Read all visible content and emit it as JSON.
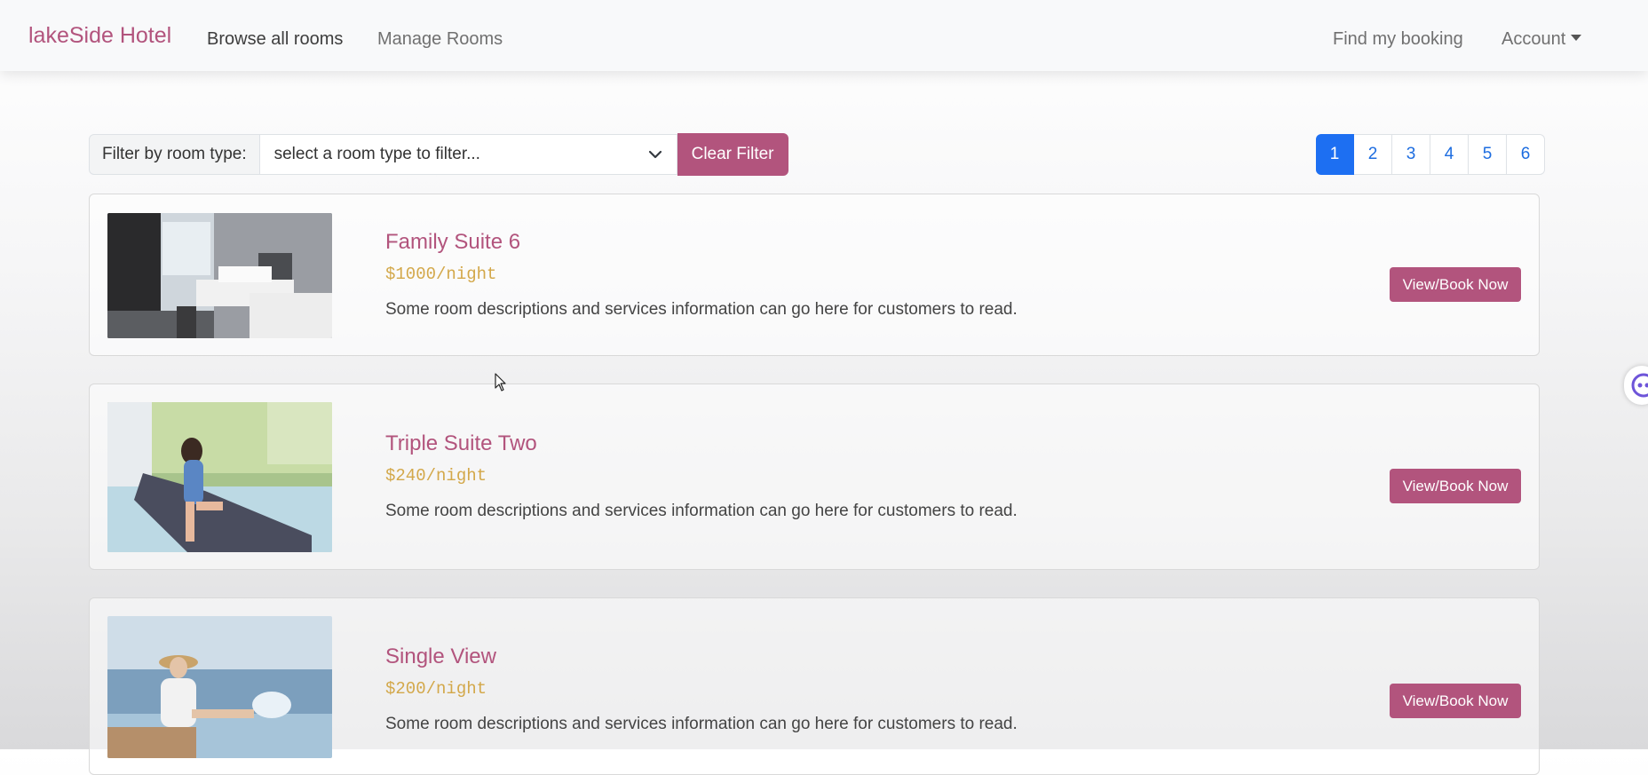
{
  "navbar": {
    "brand": "lakeSide Hotel",
    "links": [
      "Browse all rooms",
      "Manage Rooms"
    ],
    "right_links": [
      "Find my booking",
      "Account"
    ]
  },
  "filter": {
    "label": "Filter by room type:",
    "select_value": "select a room type to filter...",
    "clear_label": "Clear Filter"
  },
  "pagination": {
    "pages": [
      "1",
      "2",
      "3",
      "4",
      "5",
      "6"
    ],
    "active": "1"
  },
  "rooms": [
    {
      "title": "Family Suite 6",
      "price": "$1000/night",
      "description": "Some room descriptions and services information can go here for customers to read.",
      "button": "View/Book Now"
    },
    {
      "title": "Triple Suite Two",
      "price": "$240/night",
      "description": "Some room descriptions and services information can go here for customers to read.",
      "button": "View/Book Now"
    },
    {
      "title": "Single View",
      "price": "$200/night",
      "description": "Some room descriptions and services information can go here for customers to read.",
      "button": "View/Book Now"
    }
  ],
  "colors": {
    "brand": "#b2547d",
    "price": "#d3a84a",
    "active_page": "#1d6ff2"
  }
}
